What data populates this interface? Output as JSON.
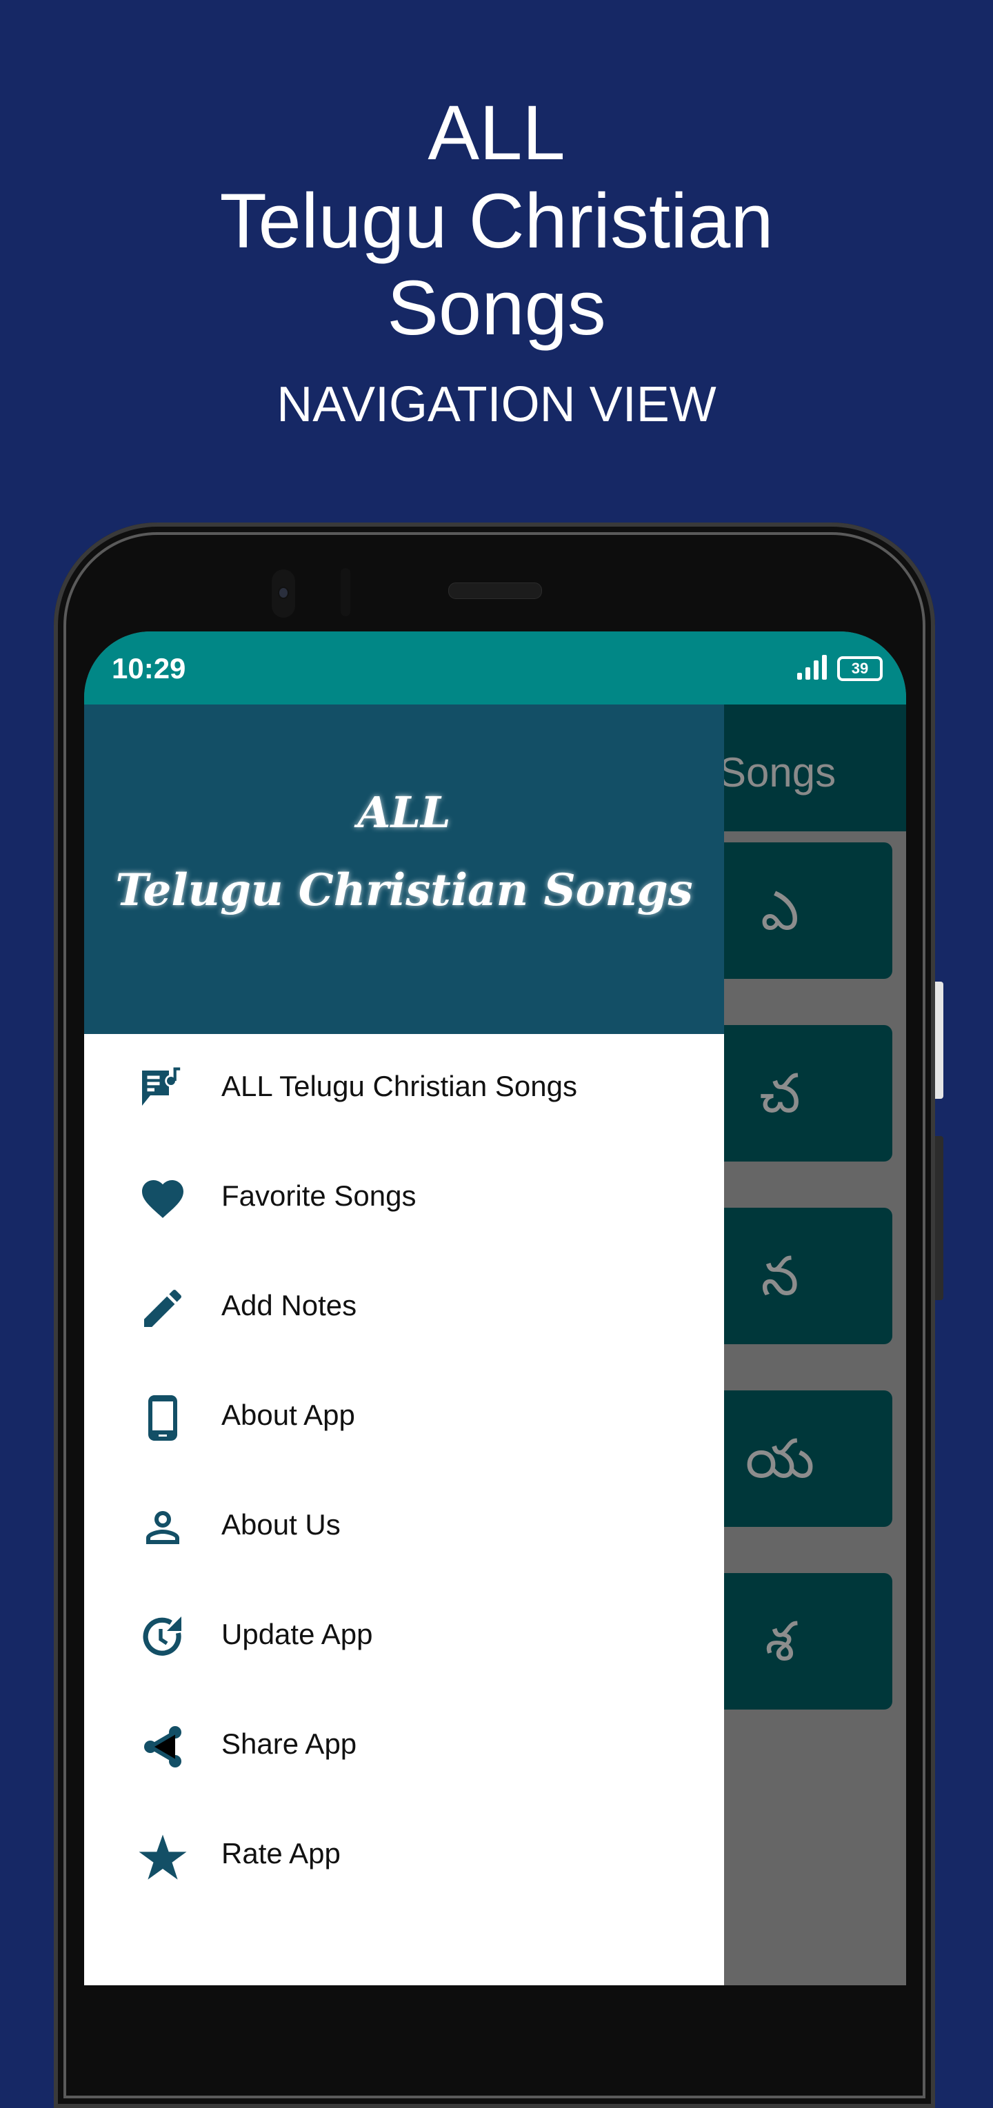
{
  "promo": {
    "title_line1": "ALL",
    "title_line2": "Telugu Christian",
    "title_line3": "Songs",
    "subtitle": "NAVIGATION VIEW"
  },
  "statusbar": {
    "time": "10:29",
    "battery_level": "39"
  },
  "app": {
    "toolbar_title_visible": "Songs",
    "letter_buttons": [
      "ఎ",
      "చ",
      "న",
      "య",
      "శ"
    ]
  },
  "drawer": {
    "header_line1": "ALL",
    "header_line2": "Telugu Christian Songs",
    "items": [
      {
        "label": "ALL Telugu Christian Songs",
        "icon": "song-lyrics-icon"
      },
      {
        "label": "Favorite Songs",
        "icon": "heart-icon"
      },
      {
        "label": "Add Notes",
        "icon": "pencil-icon"
      },
      {
        "label": "About App",
        "icon": "phone-icon"
      },
      {
        "label": "About Us",
        "icon": "person-icon"
      },
      {
        "label": "Update App",
        "icon": "update-icon"
      },
      {
        "label": "Share App",
        "icon": "share-icon"
      },
      {
        "label": "Rate App",
        "icon": "star-icon"
      }
    ]
  },
  "colors": {
    "background": "#162865",
    "statusbar": "#018786",
    "drawer_header": "#134f66",
    "icon": "#134f66",
    "letter_button": "#00373a"
  }
}
